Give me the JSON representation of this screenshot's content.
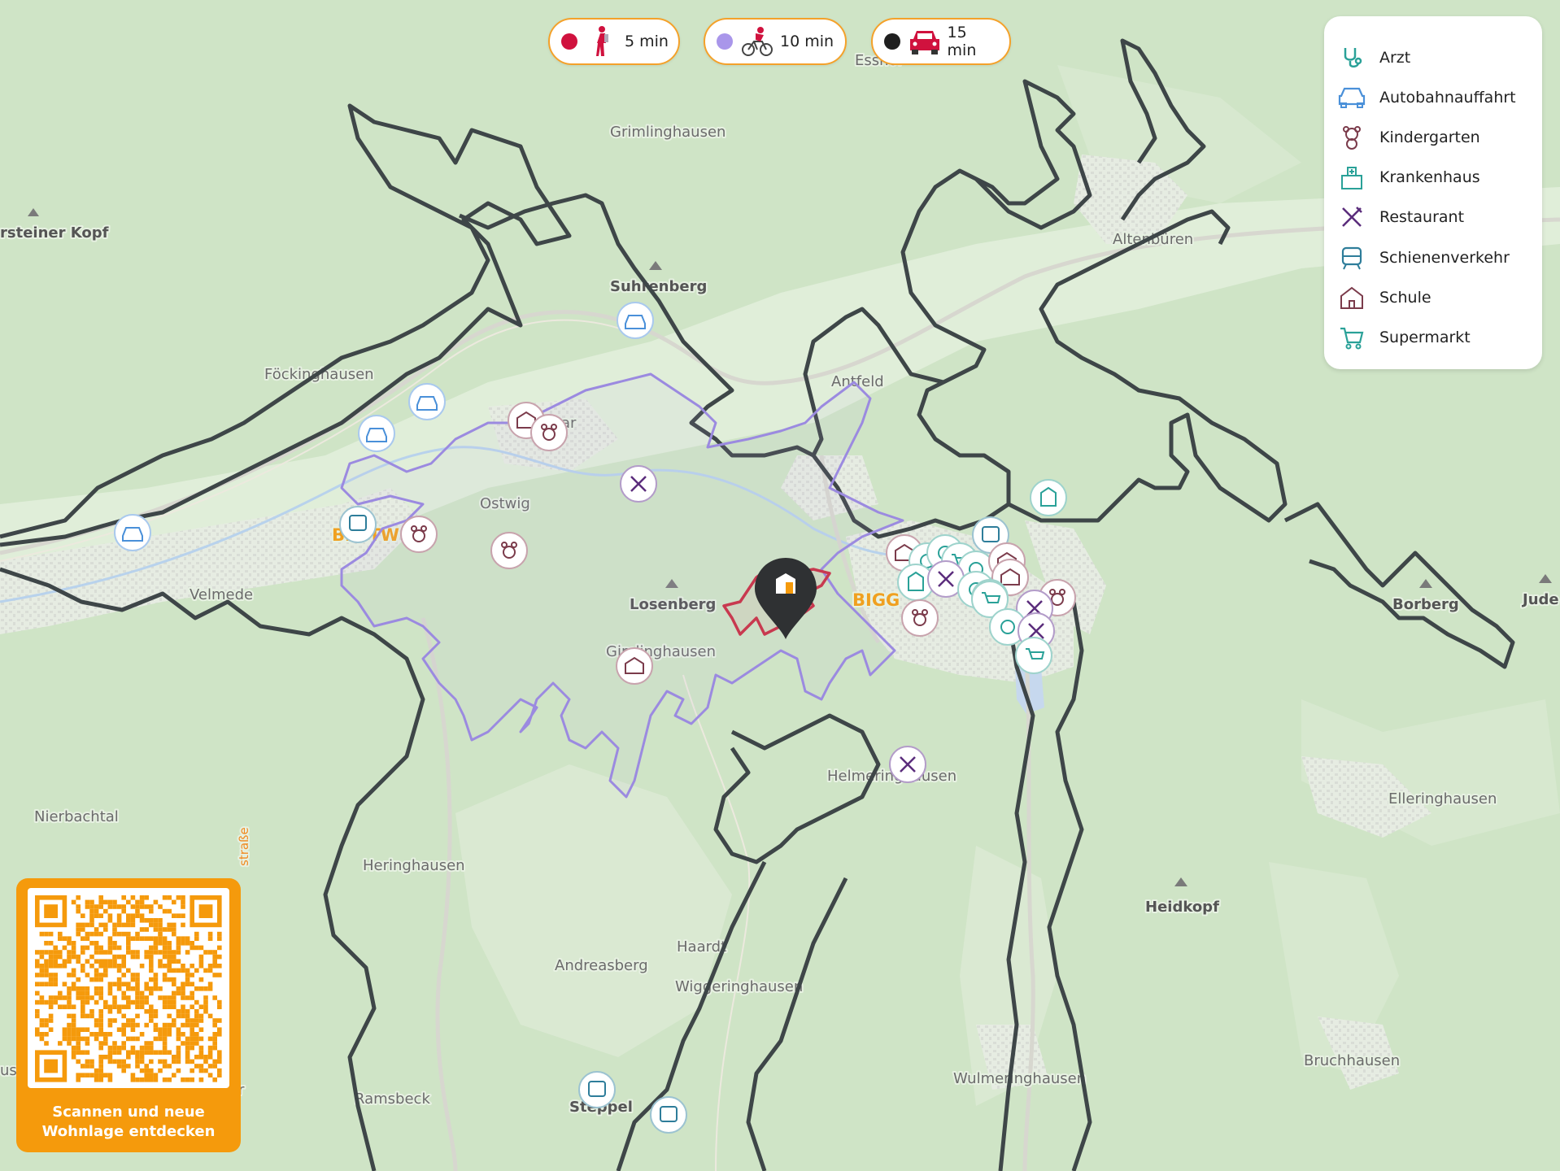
{
  "travel_legend": [
    {
      "color": "#d0123e",
      "mode_icon": "walking-person-icon",
      "label": "5 min"
    },
    {
      "color": "#a996ea",
      "mode_icon": "bicycle-icon",
      "label": "10 min"
    },
    {
      "color": "#1f1f1f",
      "mode_icon": "car-icon",
      "label": "15 min"
    }
  ],
  "poi_legend": [
    {
      "label": "Arzt",
      "icon": "stethoscope-icon",
      "color": "#2aa198"
    },
    {
      "label": "Autobahnauffahrt",
      "icon": "car-icon",
      "color": "#4a90d9"
    },
    {
      "label": "Kindergarten",
      "icon": "teddy-bear-icon",
      "color": "#7b3b4b"
    },
    {
      "label": "Krankenhaus",
      "icon": "hospital-icon",
      "color": "#2aa198"
    },
    {
      "label": "Restaurant",
      "icon": "fork-knife-icon",
      "color": "#5b2d7c"
    },
    {
      "label": "Schienenverkehr",
      "icon": "train-icon",
      "color": "#2e7d9a"
    },
    {
      "label": "Schule",
      "icon": "school-icon",
      "color": "#7b3b4b"
    },
    {
      "label": "Supermarkt",
      "icon": "cart-icon",
      "color": "#2aa198"
    }
  ],
  "places": {
    "grimlinghausen_n": "Grimlinghausen",
    "steiner_kopf": "rsteiner Kopf",
    "suhrenberg": "Suhrenberg",
    "altenbueren": "Altenbüren",
    "foeckinghausen": "Föckinghausen",
    "antfeld": "Antfeld",
    "esshoff": "Esshof",
    "ostwig": "Ostwig",
    "bestwig": "BESTW",
    "velmede": "Velmede",
    "losenberg": "Losenberg",
    "grimlinghausen_s": "Gimlinghausen",
    "bigge": "BIGG",
    "borberg": "Borberg",
    "jude": "Jude",
    "nierbachtal": "Nierbachtal",
    "helmeringhausen": "Helmeringhausen",
    "elleringhausen": "Elleringhausen",
    "heringhausen": "Heringhausen",
    "heidkopf": "Heidkopf",
    "haardt": "Haardt",
    "andreasberg": "Andreasberg",
    "wiggeringhausen": "Wiggeringhausen",
    "ramsbeck": "Ramsbeck",
    "wulmeringhausen": "Wulmeringhausen",
    "bruchhausen": "Bruchhausen",
    "steppel": "Steppel",
    "strasse": "straße",
    "use": "use",
    "ar": "ar",
    "ar2": "ar"
  },
  "qr_caption_line1": "Scannen und neue",
  "qr_caption_line2": "Wohnlage entdecken",
  "colors": {
    "walk": "#c8394f",
    "bike": "#9b8ae0",
    "car": "#3e4648",
    "accent": "#f59a0c"
  }
}
